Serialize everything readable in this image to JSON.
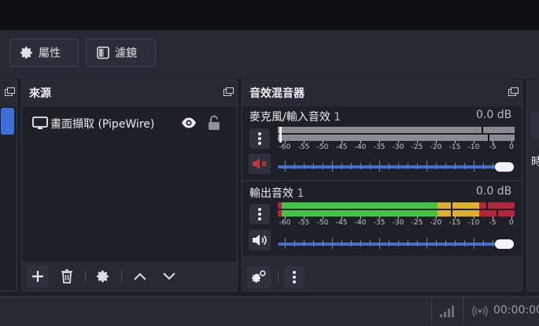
{
  "toolbar": {
    "properties_label": "屬性",
    "filters_label": "濾鏡"
  },
  "sources": {
    "title": "來源",
    "items": [
      {
        "label": "畫面擷取 (PipeWire)",
        "icon": "monitor-icon",
        "visible": true,
        "locked": false
      }
    ]
  },
  "mixer": {
    "title": "音效混音器",
    "channels": [
      {
        "name": "麥克風/輸入音效",
        "index": "1",
        "db": "0.0 dB",
        "muted": true,
        "level": 0,
        "volume": 1.0
      },
      {
        "name": "輸出音效",
        "index": "1",
        "db": "0.0 dB",
        "muted": false,
        "level": 1.0,
        "volume": 1.0
      }
    ],
    "tick_labels": [
      "-60",
      "-55",
      "-50",
      "-45",
      "-40",
      "-35",
      "-30",
      "-25",
      "-20",
      "-15",
      "-10",
      "-5",
      "0"
    ]
  },
  "partial_dock": {
    "title_glyph": "時"
  },
  "status": {
    "time": "00:00:00"
  },
  "colors": {
    "accent": "#3e6fd6",
    "meter_green": "#43c443",
    "meter_yellow": "#e0b02a",
    "meter_red": "#b2253a",
    "mute_red": "#c8323a"
  }
}
